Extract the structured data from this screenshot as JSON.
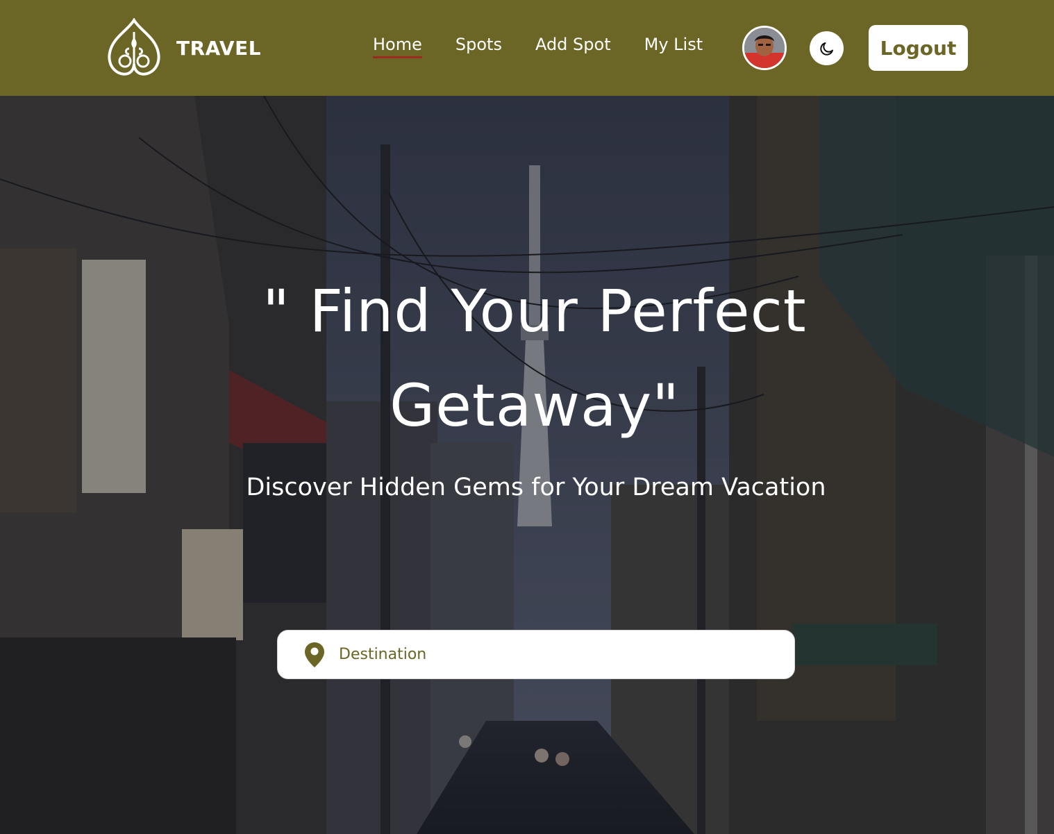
{
  "brand": {
    "name": "TRAVEL"
  },
  "nav": {
    "links": [
      {
        "label": "Home",
        "active": true
      },
      {
        "label": "Spots",
        "active": false
      },
      {
        "label": "Add Spot",
        "active": false
      },
      {
        "label": "My List",
        "active": false
      }
    ]
  },
  "user": {
    "avatar_icon": "user-avatar"
  },
  "theme_toggle": {
    "icon": "moon-icon"
  },
  "logout": {
    "label": "Logout"
  },
  "hero": {
    "title_line1": "\" Find Your Perfect",
    "title_line2": "Getaway\"",
    "subtitle": "Discover Hidden Gems for Your Dream Vacation"
  },
  "search": {
    "placeholder": "Destination",
    "value": "",
    "icon": "location-pin-icon"
  },
  "colors": {
    "navbar": "#6b6526",
    "accent": "#6b6526",
    "active_underline": "#9b2b1f",
    "text_light": "#ffffff"
  }
}
